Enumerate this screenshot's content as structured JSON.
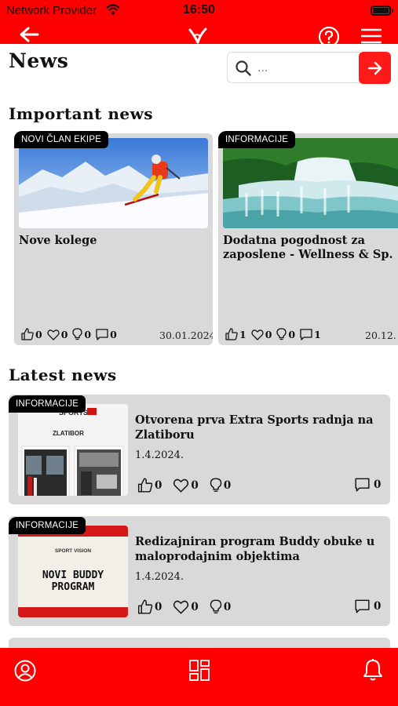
{
  "status_bar": {
    "provider": "Network Provider",
    "time": "16:50"
  },
  "header": {
    "title": "News",
    "search_placeholder": "..."
  },
  "sections": {
    "important": "Important news",
    "latest": "Latest news"
  },
  "important_news": [
    {
      "badge": "NOVI ČLAN EKIPE",
      "title": "Nove kolege",
      "likes": "0",
      "hearts": "0",
      "ideas": "0",
      "comments": "0",
      "date": "30.01.2024."
    },
    {
      "badge": "INFORMACIJE",
      "title": "Dodatna pogodnost za\nzaposlene - Wellness & Sp.",
      "likes": "1",
      "hearts": "0",
      "ideas": "0",
      "comments": "1",
      "date": "20.12."
    }
  ],
  "latest_news": [
    {
      "badge": "INFORMACIJE",
      "title": "Otvorena prva Extra Sports radnja na\nZlatiboru",
      "date": "1.4.2024.",
      "likes": "0",
      "hearts": "0",
      "ideas": "0",
      "comments": "0",
      "thumb_text": "ZLATIBOR"
    },
    {
      "badge": "INFORMACIJE",
      "title": "Redizajniran program Buddy obuke u\nmaloprodajnim objektima",
      "date": "1.4.2024.",
      "likes": "0",
      "hearts": "0",
      "ideas": "0",
      "comments": "0",
      "thumb_brand": "SPORT VISION",
      "thumb_line1": "NOVI BUDDY",
      "thumb_line2": "PROGRAM"
    }
  ],
  "colors": {
    "brand_red": "#ff0000",
    "card_gray": "#d9d9d9",
    "badge_black": "#000000"
  }
}
